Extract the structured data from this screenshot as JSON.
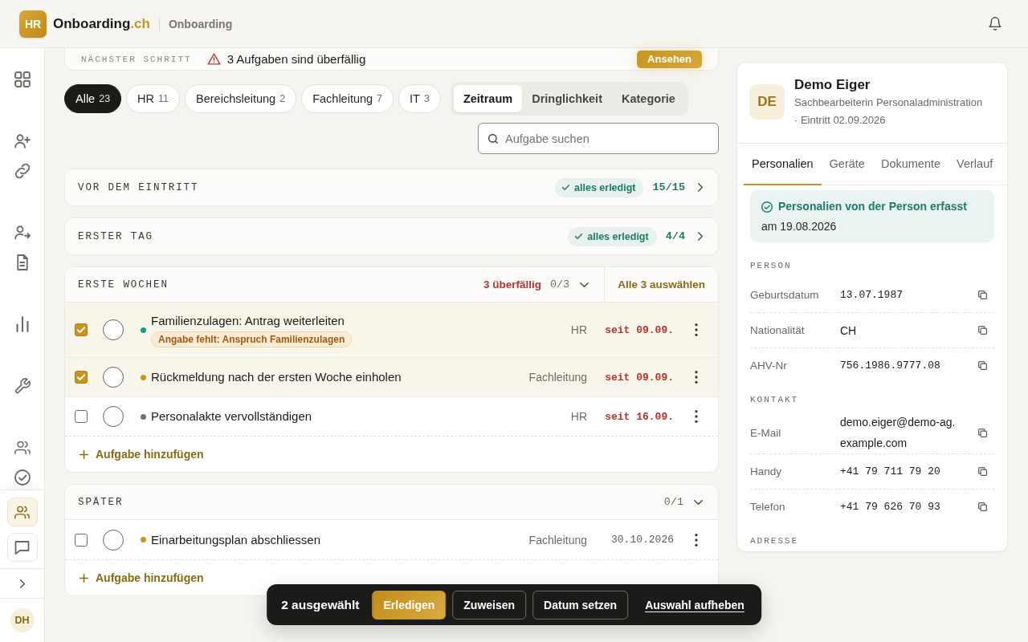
{
  "header": {
    "logo": "HR",
    "brand": "Onboarding",
    "brand_domain": ".ch",
    "section": "Onboarding"
  },
  "sidebar": {
    "groups": [
      {
        "items": [
          {
            "kind": "grid",
            "selected": false
          }
        ]
      },
      {
        "items": [
          {
            "kind": "adduser",
            "selected": false
          },
          {
            "kind": "link",
            "selected": false
          }
        ]
      },
      {
        "items": [
          {
            "kind": "userarrow",
            "selected": false
          },
          {
            "kind": "document",
            "selected": false
          }
        ]
      },
      {
        "items": [
          {
            "kind": "chart",
            "selected": false
          }
        ]
      },
      {
        "items": [
          {
            "kind": "wrench",
            "selected": false
          }
        ]
      },
      {
        "items": [
          {
            "kind": "team",
            "selected": false
          },
          {
            "kind": "checkcircle",
            "selected": false
          }
        ]
      }
    ],
    "pinned": [
      {
        "kind": "team",
        "selected": true
      },
      {
        "kind": "chat",
        "selected": false
      }
    ],
    "user_initials": "DH"
  },
  "next_step": {
    "label": "NÄCHSTER SCHRITT",
    "message": "3 Aufgaben sind überfällig",
    "action": "Ansehen"
  },
  "filters": [
    {
      "label": "Alle",
      "count": "23",
      "selected": true
    },
    {
      "label": "HR",
      "count": "11",
      "selected": false
    },
    {
      "label": "Bereichsleitung",
      "count": "2",
      "selected": false
    },
    {
      "label": "Fachleitung",
      "count": "7",
      "selected": false
    },
    {
      "label": "IT",
      "count": "3",
      "selected": false
    }
  ],
  "group_by": [
    {
      "label": "Zeitraum",
      "selected": true
    },
    {
      "label": "Dringlichkeit",
      "selected": false
    },
    {
      "label": "Kategorie",
      "selected": false
    }
  ],
  "search": {
    "placeholder": "Aufgabe suchen"
  },
  "sections": [
    {
      "title": "VOR DEM EINTRITT",
      "expanded": false,
      "complete": true,
      "badge": "alles erledigt",
      "progress": "15/15"
    },
    {
      "title": "ERSTER TAG",
      "expanded": false,
      "complete": true,
      "badge": "alles erledigt",
      "progress": "4/4"
    },
    {
      "title": "ERSTE WOCHEN",
      "expanded": true,
      "complete": false,
      "overdue": "3 überfällig",
      "progress": "0/3",
      "select_all": "Alle 3 auswählen",
      "tasks": [
        {
          "title": "Familienzulagen: Antrag weiterleiten",
          "selected": true,
          "done": false,
          "color": "#1a9a8a",
          "tag": "Angabe fehlt: Anspruch Familienzulagen",
          "assignee": "HR",
          "due": "seit 09.09.",
          "overdue": true
        },
        {
          "title": "Rückmeldung nach der ersten Woche einholen",
          "selected": true,
          "done": false,
          "color": "#c8961e",
          "assignee": "Fachleitung",
          "due": "seit 09.09.",
          "overdue": true
        },
        {
          "title": "Personalakte vervollständigen",
          "selected": false,
          "done": false,
          "color": "#75726d",
          "assignee": "HR",
          "due": "seit 16.09.",
          "overdue": true
        }
      ],
      "add_label": "Aufgabe hinzufügen"
    },
    {
      "title": "SPÄTER",
      "expanded": true,
      "complete": false,
      "progress": "0/1",
      "tasks": [
        {
          "title": "Einarbeitungsplan abschliessen",
          "selected": false,
          "done": false,
          "color": "#c8961e",
          "assignee": "Fachleitung",
          "due": "30.10.2026",
          "overdue": false
        }
      ],
      "add_label": "Aufgabe hinzufügen"
    }
  ],
  "detail_panel": {
    "initials": "DE",
    "name": "Demo Eiger",
    "subtitle": "Sachbearbeiterin Personaladministration · Eintritt 02.09.2026",
    "tabs": [
      {
        "label": "Personalien",
        "selected": true
      },
      {
        "label": "Geräte",
        "selected": false
      },
      {
        "label": "Dokumente",
        "selected": false
      },
      {
        "label": "Verlauf",
        "selected": false
      }
    ],
    "notice": {
      "title": "Personalien von der Person erfasst",
      "date": "am 19.08.2026"
    },
    "groups": [
      {
        "title": "PERSON",
        "fields": [
          {
            "label": "Geburtsdatum",
            "value": "13.07.1987",
            "kind": "mono"
          },
          {
            "label": "Nationalität",
            "value": "CH",
            "kind": "text"
          },
          {
            "label": "AHV-Nr",
            "value": "756.1986.9777.08",
            "kind": "mono"
          }
        ]
      },
      {
        "title": "KONTAKT",
        "fields": [
          {
            "label": "E-Mail",
            "value": "demo.eiger@demo-ag.example.com",
            "kind": "text"
          },
          {
            "label": "Handy",
            "value": "+41 79 711 79 20",
            "kind": "mono"
          },
          {
            "label": "Telefon",
            "value": "+41 79 626 70 93",
            "kind": "mono"
          }
        ]
      },
      {
        "title": "ADRESSE"
      }
    ]
  },
  "selection_bar": {
    "count_label": "2 ausgewählt",
    "primary_action": "Erledigen",
    "actions": [
      "Zuweisen",
      "Datum setzen"
    ],
    "clear": "Auswahl aufheben"
  }
}
